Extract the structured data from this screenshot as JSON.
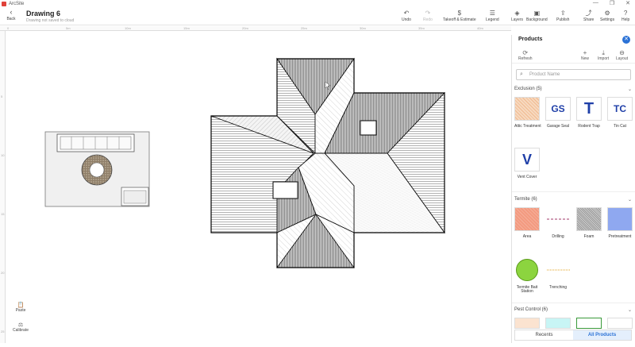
{
  "app": {
    "name": "ArcSite"
  },
  "window_controls": [
    "—",
    "❐",
    "✕"
  ],
  "toolbar": {
    "back_label": "Back",
    "doc_title": "Drawing 6",
    "doc_subtitle": "Drawing not saved to cloud",
    "undo": "Undo",
    "redo": "Redo",
    "takeoff": "Takeoff & Estimate",
    "legend": "Legend",
    "layers": "Layers",
    "background": "Background",
    "publish": "Publish",
    "share": "Share",
    "settings": "Settings",
    "help": "Help"
  },
  "ruler": {
    "h_ticks": [
      "0",
      "5m",
      "10m",
      "15m",
      "20m",
      "25m",
      "30m",
      "35m",
      "40m"
    ],
    "v_ticks": [
      "5",
      "10",
      "15",
      "20",
      "25"
    ]
  },
  "left_tools": {
    "paste": "Paste",
    "calibrate": "Calibrate"
  },
  "panel": {
    "title": "Products",
    "actions": {
      "refresh": "Refresh",
      "new": "New",
      "import": "Import",
      "layout": "Layout"
    },
    "search_placeholder": "Product Name",
    "sections": [
      {
        "title": "Exclusion (5)",
        "items": [
          {
            "label": "Attic Treatment",
            "swatch": "#f4c9a6"
          },
          {
            "label": "Garage Seal",
            "glyph": "GS"
          },
          {
            "label": "Rodent Trap",
            "glyph": "T"
          },
          {
            "label": "Tin Cat",
            "glyph": "TC"
          },
          {
            "label": "Vent Cover",
            "glyph": "V"
          }
        ]
      },
      {
        "title": "Termite (6)",
        "items": [
          {
            "label": "Area",
            "swatch": "#f39a80"
          },
          {
            "label": "Drilling",
            "swatch": "#ffffff"
          },
          {
            "label": "Foam",
            "swatch": "#b0b0b0"
          },
          {
            "label": "Pretreatment",
            "swatch": "#8fa8f0"
          },
          {
            "label": "Termite Bait Station",
            "swatch": "#8cd43f"
          },
          {
            "label": "Trenching",
            "swatch": "#ffffff"
          }
        ]
      },
      {
        "title": "Pest Control (6)"
      }
    ],
    "tabs": {
      "recents": "Recents",
      "all": "All Products"
    }
  },
  "colors": {
    "accent": "#2b72d6",
    "brand": "#e0413a",
    "glyph": "#1f3fa8"
  }
}
